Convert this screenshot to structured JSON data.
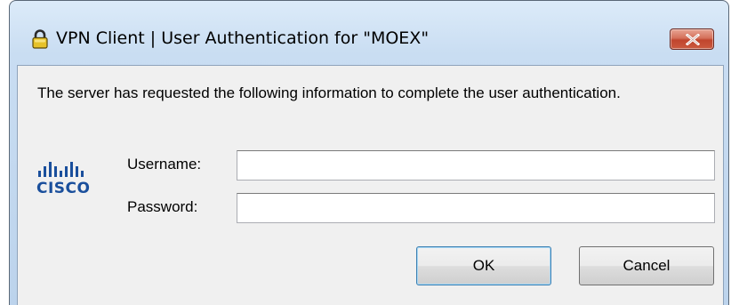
{
  "window": {
    "title": "VPN Client  |  User Authentication for \"MOEX\""
  },
  "icons": {
    "title_icon": "lock-icon",
    "close_icon": "close-icon",
    "logo": "cisco-logo"
  },
  "logo": {
    "word": "CISCO"
  },
  "dialog": {
    "message": "The server has requested the following information to complete the user authentication."
  },
  "form": {
    "username_label": "Username:",
    "username_value": "",
    "password_label": "Password:",
    "password_value": ""
  },
  "buttons": {
    "ok": "OK",
    "cancel": "Cancel"
  },
  "colors": {
    "cisco_blue": "#1a4f9c",
    "close_red": "#c0452d",
    "titlebar": "#c9ddf2",
    "client_bg": "#f0f0f0"
  }
}
